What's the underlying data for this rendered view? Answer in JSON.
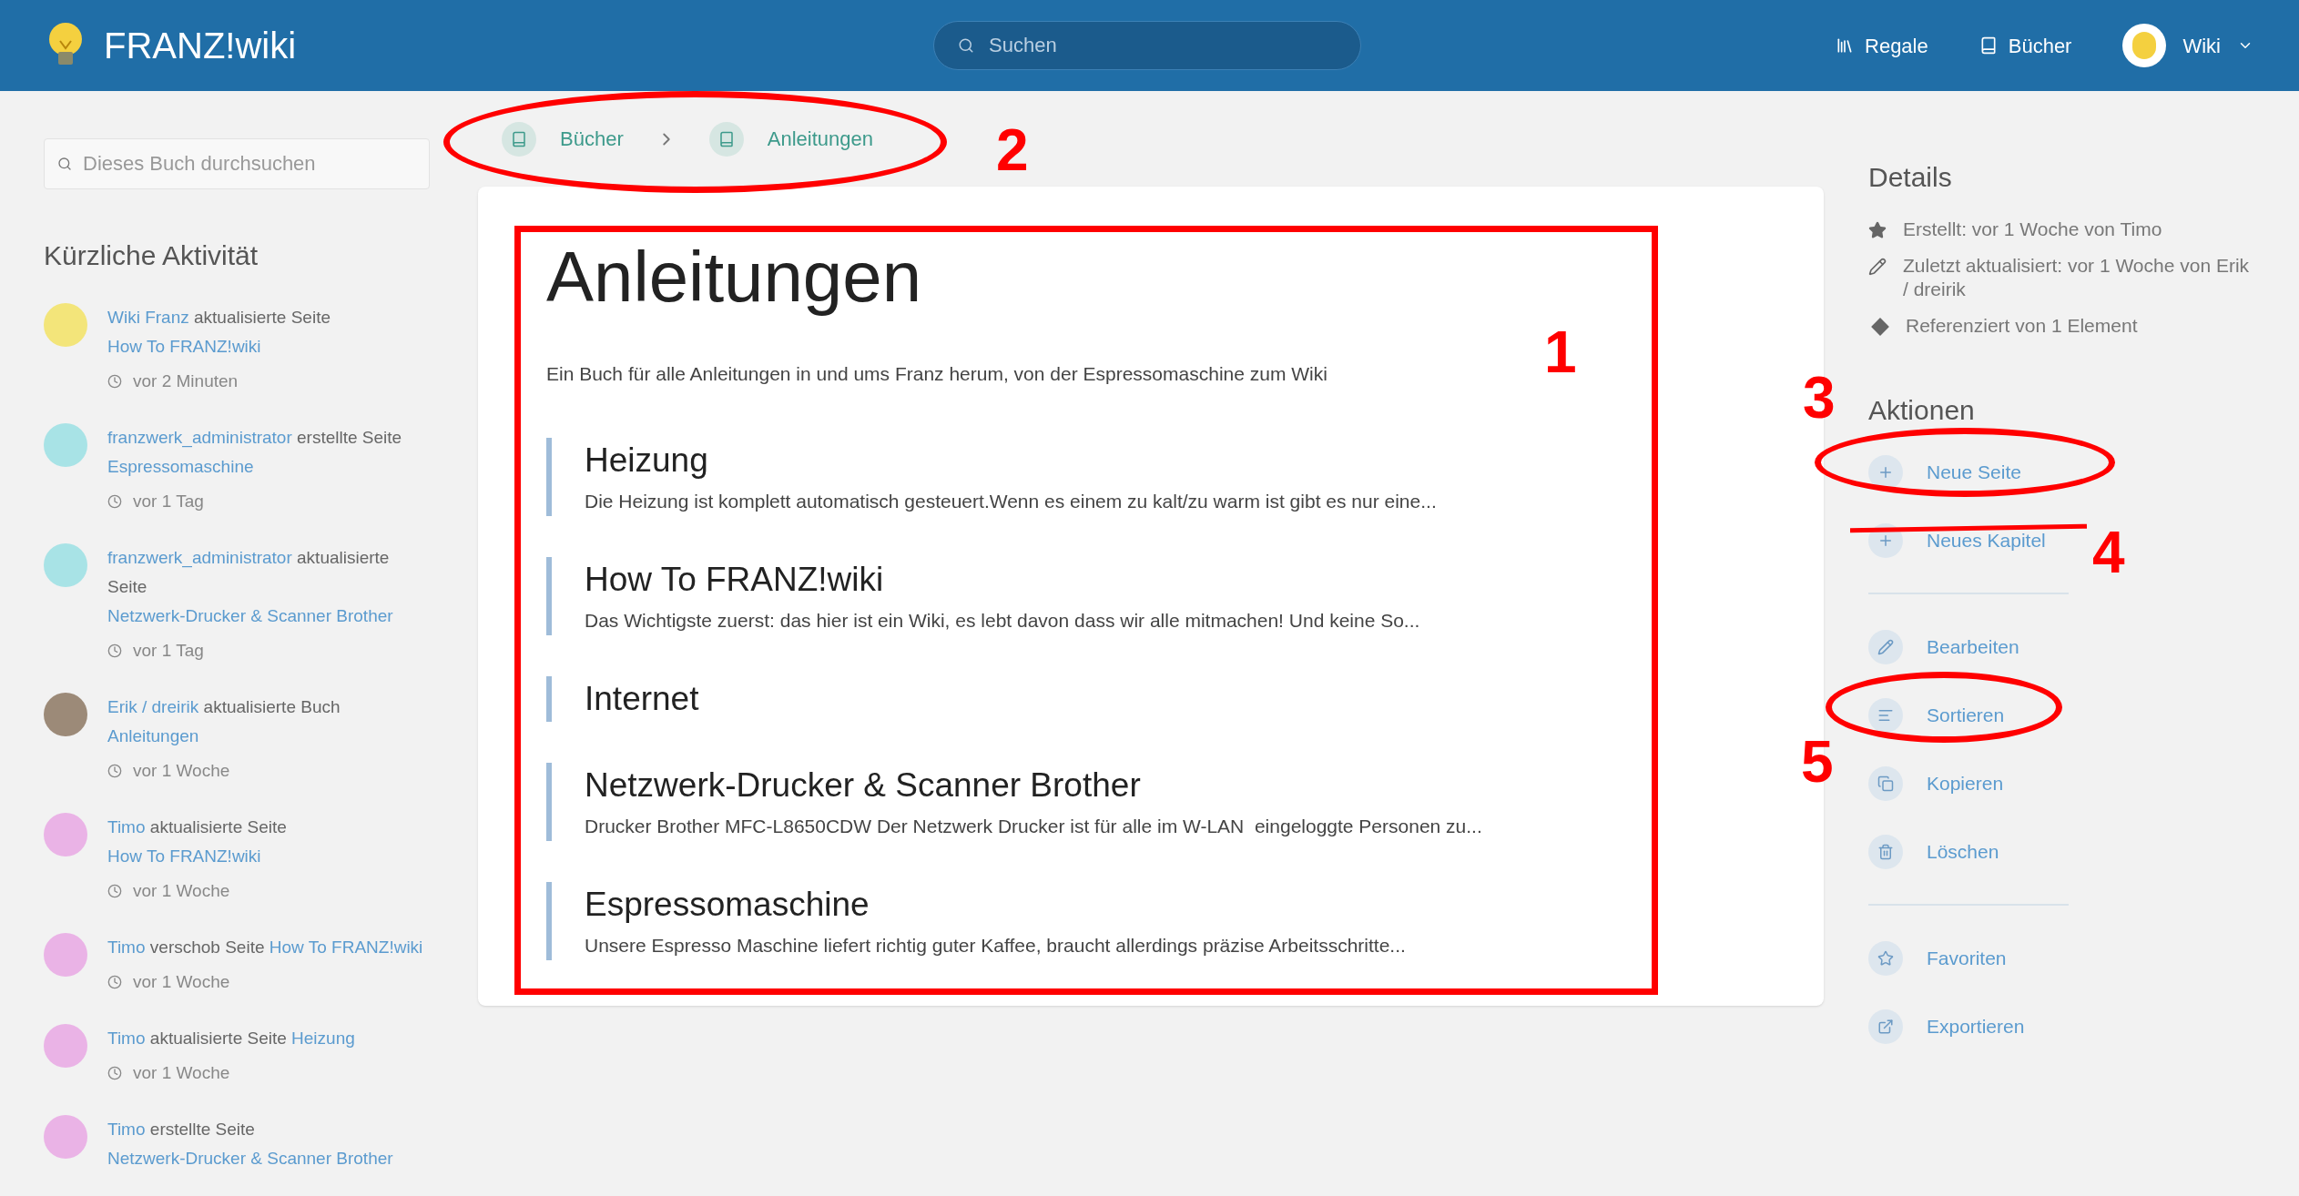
{
  "header": {
    "title": "FRANZ!wiki",
    "search": {
      "placeholder": "Suchen"
    },
    "nav": [
      "Regale",
      "Bücher"
    ],
    "user": "Wiki"
  },
  "sidebar": {
    "search": {
      "placeholder": "Dieses Buch durchsuchen"
    },
    "activity_title": "Kürzliche Aktivität",
    "activity": [
      {
        "user": "Wiki Franz",
        "action": "aktualisierte Seite",
        "target": "How To FRANZ!wiki",
        "time": "vor 2 Minuten",
        "color": "#f3e57a"
      },
      {
        "user": "franzwerk_administrator",
        "action": "erstellte Seite",
        "target": "Espressomaschine",
        "time": "vor 1 Tag",
        "color": "#a8e3e6"
      },
      {
        "user": "franzwerk_administrator",
        "action": "aktualisierte Seite",
        "target": "Netzwerk-Drucker & Scanner Brother",
        "time": "vor 1 Tag",
        "color": "#a8e3e6"
      },
      {
        "user": "Erik / dreirik",
        "action": "aktualisierte Buch",
        "target": "Anleitungen",
        "time": "vor 1 Woche",
        "color": "#9c8a78"
      },
      {
        "user": "Timo",
        "action": "aktualisierte Seite",
        "target": "How To FRANZ!wiki",
        "time": "vor 1 Woche",
        "color": "#eab3e6"
      },
      {
        "user": "Timo",
        "action": "verschob Seite",
        "target": "How To FRANZ!wiki",
        "time": "vor 1 Woche",
        "color": "#eab3e6"
      },
      {
        "user": "Timo",
        "action": "aktualisierte Seite",
        "target": "Heizung",
        "time": "vor 1 Woche",
        "color": "#eab3e6"
      },
      {
        "user": "Timo",
        "action": "erstellte Seite",
        "target": "Netzwerk-Drucker & Scanner Brother",
        "color": "#eab3e6"
      }
    ]
  },
  "breadcrumbs": [
    "Bücher",
    "Anleitungen"
  ],
  "book": {
    "title": "Anleitungen",
    "description": "Ein Buch für alle Anleitungen in und ums Franz herum, von der Espressomaschine zum Wiki",
    "pages": [
      {
        "title": "Heizung",
        "excerpt": "Die Heizung ist komplett automatisch gesteuert.Wenn es einem zu kalt/zu warm ist gibt es nur eine..."
      },
      {
        "title": "How To FRANZ!wiki",
        "excerpt": "Das Wichtigste zuerst: das hier ist ein Wiki, es lebt davon dass wir alle mitmachen! Und keine So..."
      },
      {
        "title": "Internet"
      },
      {
        "title": "Netzwerk-Drucker & Scanner Brother",
        "excerpt": "Drucker Brother MFC-L8650CDW Der Netzwerk Drucker ist für alle im W-LAN  eingeloggte Personen zu..."
      },
      {
        "title": "Espressomaschine",
        "excerpt": "Unsere Espresso Maschine liefert richtig guter Kaffee, braucht allerdings präzise Arbeitsschritte..."
      }
    ]
  },
  "details": {
    "title": "Details",
    "items": [
      "Erstellt: vor 1 Woche von Timo",
      "Zuletzt aktualisiert: vor 1 Woche von Erik / dreirik",
      "Referenziert von 1 Element"
    ]
  },
  "actions": {
    "title": "Aktionen",
    "groups": [
      [
        "Neue Seite",
        "Neues Kapitel"
      ],
      [
        "Bearbeiten",
        "Sortieren",
        "Kopieren",
        "Löschen"
      ],
      [
        "Favoriten",
        "Exportieren"
      ]
    ]
  },
  "annotations": [
    {
      "kind": "rectangle"
    },
    {
      "kind": "ellipse"
    },
    {
      "kind": "ellipse"
    },
    {
      "kind": "ellipse"
    },
    {
      "kind": "strike"
    },
    {
      "kind": "number",
      "text": "1"
    },
    {
      "kind": "number",
      "text": "2"
    },
    {
      "kind": "number",
      "text": "3"
    },
    {
      "kind": "number",
      "text": "4"
    },
    {
      "kind": "number",
      "text": "5"
    }
  ]
}
